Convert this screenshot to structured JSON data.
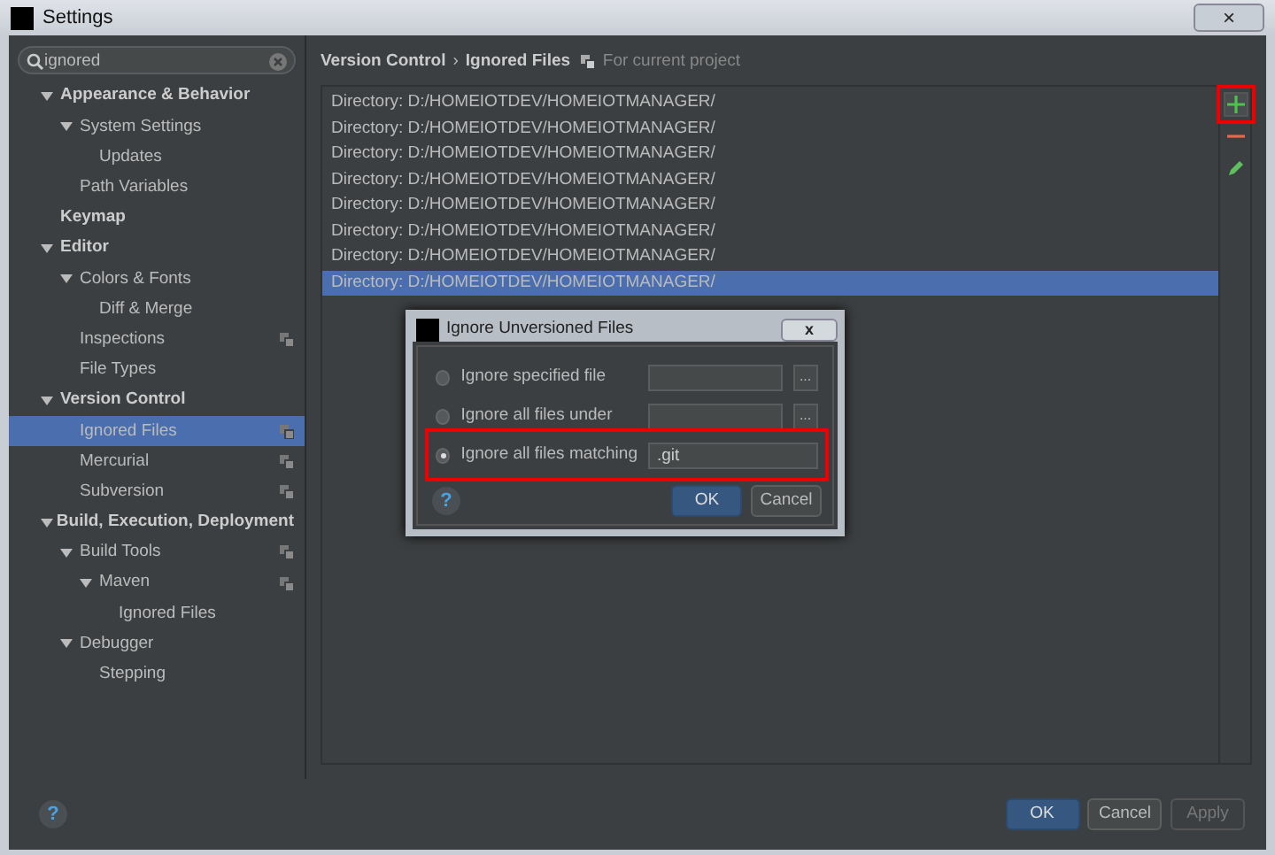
{
  "window": {
    "title": "Settings",
    "close": "×"
  },
  "search": {
    "value": "ignored"
  },
  "tree": [
    {
      "label": "Appearance & Behavior",
      "bold": true,
      "expanded": true,
      "selected": false,
      "children": [
        {
          "label": "System Settings",
          "expanded": true,
          "selected": false,
          "children": [
            {
              "label": "Updates",
              "selected": false
            }
          ]
        },
        {
          "label": "Path Variables",
          "selected": false
        }
      ]
    },
    {
      "label": "Keymap",
      "bold": true,
      "selected": false
    },
    {
      "label": "Editor",
      "bold": true,
      "expanded": true,
      "selected": false,
      "children": [
        {
          "label": "Colors & Fonts",
          "expanded": true,
          "selected": false,
          "children": [
            {
              "label": "Diff & Merge",
              "selected": false
            }
          ]
        },
        {
          "label": "Inspections",
          "project": true,
          "selected": false
        },
        {
          "label": "File Types",
          "selected": false
        }
      ]
    },
    {
      "label": "Version Control",
      "bold": true,
      "expanded": true,
      "selected": false,
      "children": [
        {
          "label": "Ignored Files",
          "project": true,
          "selected": true
        },
        {
          "label": "Mercurial",
          "project": true,
          "selected": false
        },
        {
          "label": "Subversion",
          "project": true,
          "selected": false
        }
      ]
    },
    {
      "label": "Build, Execution, Deployment",
      "bold": true,
      "expanded": true,
      "selected": false,
      "children": [
        {
          "label": "Build Tools",
          "project": true,
          "expanded": true,
          "selected": false,
          "children": [
            {
              "label": "Maven",
              "project": true,
              "expanded": true,
              "selected": false,
              "children": [
                {
                  "label": "Ignored Files",
                  "selected": false
                }
              ]
            }
          ]
        },
        {
          "label": "Debugger",
          "expanded": true,
          "selected": false,
          "children": [
            {
              "label": "Stepping",
              "selected": false
            }
          ]
        }
      ]
    }
  ],
  "breadcrumb": {
    "parent": "Version Control",
    "separator": "›",
    "current": "Ignored Files",
    "scope": "For current project"
  },
  "entries": [
    {
      "text": "Directory: D:/HOMEIOTDEV/HOMEIOTMANAGER/",
      "selected": false
    },
    {
      "text": "Directory: D:/HOMEIOTDEV/HOMEIOTMANAGER/",
      "selected": false
    },
    {
      "text": "Directory: D:/HOMEIOTDEV/HOMEIOTMANAGER/",
      "selected": false
    },
    {
      "text": "Directory: D:/HOMEIOTDEV/HOMEIOTMANAGER/",
      "selected": false
    },
    {
      "text": "Directory: D:/HOMEIOTDEV/HOMEIOTMANAGER/",
      "selected": false
    },
    {
      "text": "Directory: D:/HOMEIOTDEV/HOMEIOTMANAGER/",
      "selected": false
    },
    {
      "text": "Directory: D:/HOMEIOTDEV/HOMEIOTMANAGER/",
      "selected": false
    },
    {
      "text": "Directory: D:/HOMEIOTDEV/HOMEIOTMANAGER/",
      "selected": true
    }
  ],
  "toolbar": [
    {
      "kind": "add",
      "highlighted": true
    },
    {
      "kind": "remove",
      "highlighted": false
    },
    {
      "kind": "edit",
      "highlighted": false
    }
  ],
  "dialog": {
    "title": "Ignore Unversioned Files",
    "close": "x",
    "options": [
      {
        "label": "Ignore specified file",
        "selected": false,
        "browse": "...",
        "highlighted": false
      },
      {
        "label": "Ignore all files under",
        "selected": false,
        "browse": "...",
        "highlighted": false
      },
      {
        "label": "Ignore all files matching",
        "selected": true,
        "value": ".git",
        "highlighted": true
      }
    ],
    "help": "?",
    "buttons": [
      {
        "label": "OK",
        "default": true
      },
      {
        "label": "Cancel",
        "default": false
      }
    ]
  },
  "footer": {
    "help": "?",
    "buttons": [
      {
        "label": "OK",
        "default": true,
        "disabled": false
      },
      {
        "label": "Cancel",
        "default": false,
        "disabled": false
      },
      {
        "label": "Apply",
        "default": false,
        "disabled": true
      }
    ]
  }
}
